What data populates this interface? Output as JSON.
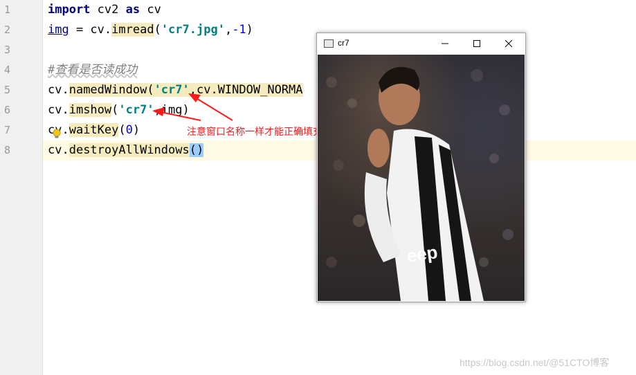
{
  "editor": {
    "line_numbers": [
      "1",
      "2",
      "3",
      "4",
      "5",
      "6",
      "7",
      "8"
    ],
    "lines": [
      {
        "import_kw": "import",
        "mod": " cv2 ",
        "as_kw": "as",
        "alias": " cv"
      },
      {
        "var": "img",
        "eq": " = cv.",
        "func": "imread",
        "open": "(",
        "str": "'cr7.jpg'",
        "comma": ",",
        "num": "-1",
        "close": ")"
      },
      {},
      {
        "comment": "#查看是否读成功"
      },
      {
        "obj": "cv.",
        "func": "namedWindow",
        "open": "(",
        "str": "'cr7'",
        "rest": ",cv.WINDOW_NORMA"
      },
      {
        "obj": "cv.",
        "func": "imshow",
        "open": "(",
        "str": "'cr7'",
        "rest": ",img)"
      },
      {
        "obj": "cv.",
        "func": "waitKey",
        "open": "(",
        "num": "0",
        "close": ")"
      },
      {
        "obj": "cv.",
        "func": "destroyAllWindows",
        "paren": "()"
      }
    ]
  },
  "window": {
    "title": "cr7",
    "minimize_icon": "minimize-icon",
    "maximize_icon": "maximize-icon",
    "close_icon": "close-icon"
  },
  "annotation": {
    "text": "注意窗口名称一样才能正确填充",
    "color": "#ff1a1a"
  },
  "watermark": "https://blog.csdn.net/@51CTO博客",
  "colors": {
    "keyword": "#000080",
    "string": "#008080",
    "number": "#0000ff",
    "highlight": "#f6ebbc",
    "current_line": "#fffae3"
  }
}
